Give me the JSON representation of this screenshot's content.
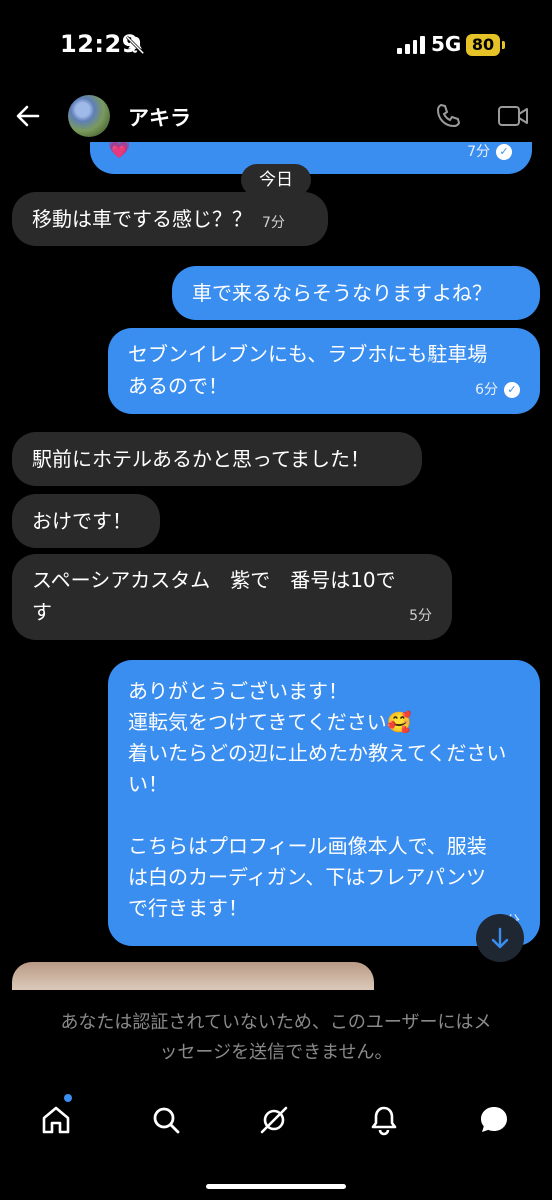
{
  "status_bar": {
    "time": "12:29",
    "network": "5G",
    "battery": "80"
  },
  "header": {
    "contact_name": "アキラ"
  },
  "messages": {
    "top_partial": {
      "emoji": "💗",
      "time": "7分"
    },
    "day_label": "今日",
    "m1": {
      "text": "移動は車でする感じ？？",
      "time": "7分"
    },
    "m2": {
      "text": "車で来るならそうなりますよね？"
    },
    "m3": {
      "line1": "セブンイレブンにも、ラブホにも駐車場",
      "line2": "あるので！",
      "time": "6分"
    },
    "m4": {
      "text": "駅前にホテルあるかと思ってました！"
    },
    "m5": {
      "text": "おけです！"
    },
    "m6": {
      "line1": "スペーシアカスタム　紫で　番号は10で",
      "line2": "す",
      "time": "5分"
    },
    "m7": {
      "line1": "ありがとうございます！",
      "line2": "運転気をつけてきてください🥰",
      "line3": "着いたらどの辺に止めたか教えてください",
      "line4": "い！",
      "line5": "こちらはプロフィール画像本人で、服装",
      "line6": "は白のカーディガン、下はフレアパンツ",
      "line7": "で行きます！",
      "time": "4分"
    }
  },
  "notice": {
    "line1": "あなたは認証されていないため、このユーザーにはメ",
    "line2": "ッセージを送信できません。"
  },
  "colors": {
    "outgoing_bubble": "#3a8ef0",
    "incoming_bubble": "#2a2a2a",
    "battery": "#e6c229"
  },
  "icons": {
    "nav": [
      "home-icon",
      "search-icon",
      "grok-icon",
      "notifications-icon",
      "messages-icon"
    ]
  }
}
